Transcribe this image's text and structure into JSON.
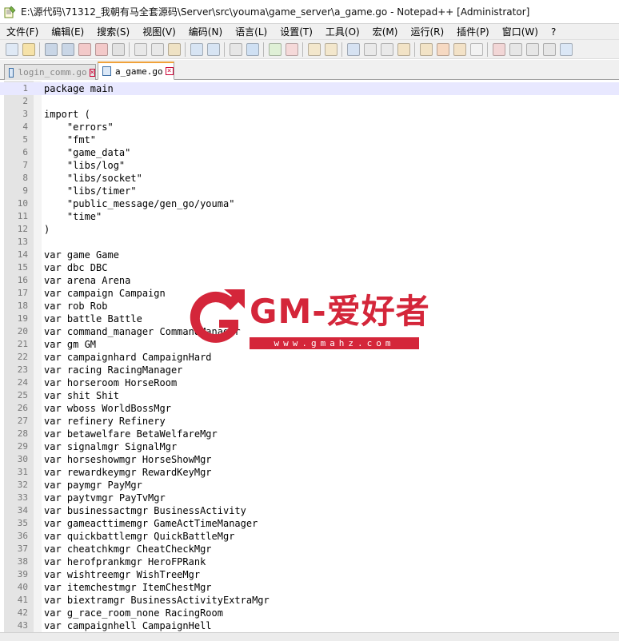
{
  "window": {
    "title": "E:\\源代码\\71312_我朝有马全套源码\\Server\\src\\youma\\game_server\\a_game.go - Notepad++ [Administrator]"
  },
  "menu": {
    "items": [
      "文件(F)",
      "编辑(E)",
      "搜索(S)",
      "视图(V)",
      "编码(N)",
      "语言(L)",
      "设置(T)",
      "工具(O)",
      "宏(M)",
      "运行(R)",
      "插件(P)",
      "窗口(W)",
      "?"
    ]
  },
  "toolbar": {
    "icons": [
      "new-file-icon",
      "open-file-icon",
      "save-icon",
      "save-all-icon",
      "close-icon",
      "close-all-icon",
      "print-icon",
      "cut-icon",
      "copy-icon",
      "paste-icon",
      "undo-icon",
      "redo-icon",
      "find-icon",
      "replace-icon",
      "zoom-in-icon",
      "zoom-out-icon",
      "sync-v-icon",
      "sync-h-icon",
      "word-wrap-icon",
      "show-all-chars-icon",
      "indent-guide-icon",
      "user-lang-icon",
      "doc-map-icon",
      "function-list-icon",
      "folder-workspace-icon",
      "monitor-icon",
      "record-macro-icon",
      "stop-macro-icon",
      "play-macro-icon",
      "run-macro-multiple-icon",
      "save-macro-icon"
    ]
  },
  "tabs": [
    {
      "label": "login_comm.go",
      "active": false
    },
    {
      "label": "a_game.go",
      "active": true
    }
  ],
  "editor": {
    "current_line": 1,
    "lines": [
      "package main",
      "",
      "import (",
      "    \"errors\"",
      "    \"fmt\"",
      "    \"game_data\"",
      "    \"libs/log\"",
      "    \"libs/socket\"",
      "    \"libs/timer\"",
      "    \"public_message/gen_go/youma\"",
      "    \"time\"",
      ")",
      "",
      "var game Game",
      "var dbc DBC",
      "var arena Arena",
      "var campaign Campaign",
      "var rob Rob",
      "var battle Battle",
      "var command_manager CommandManager",
      "var gm GM",
      "var campaignhard CampaignHard",
      "var racing RacingManager",
      "var horseroom HorseRoom",
      "var shit Shit",
      "var wboss WorldBossMgr",
      "var refinery Refinery",
      "var betawelfare BetaWelfareMgr",
      "var signalmgr SignalMgr",
      "var horseshowmgr HorseShowMgr",
      "var rewardkeymgr RewardKeyMgr",
      "var paymgr PayMgr",
      "var paytvmgr PayTvMgr",
      "var businessactmgr BusinessActivity",
      "var gameacttimemgr GameActTimeManager",
      "var quickbattlemgr QuickBattleMgr",
      "var cheatchkmgr CheatCheckMgr",
      "var herofprankmgr HeroFPRank",
      "var wishtreemgr WishTreeMgr",
      "var itemchestmgr ItemChestMgr",
      "var biextramgr BusinessActivityExtraMgr",
      "var g_race_room_none RacingRoom",
      "var campaignhell CampaignHell"
    ]
  },
  "watermark": {
    "brand": "GM-爱好者",
    "url": "www.gmahz.com"
  },
  "colors": {
    "accent_tab": "#f0a23a",
    "watermark_red": "#d4263a",
    "current_line": "#e8e8ff"
  }
}
